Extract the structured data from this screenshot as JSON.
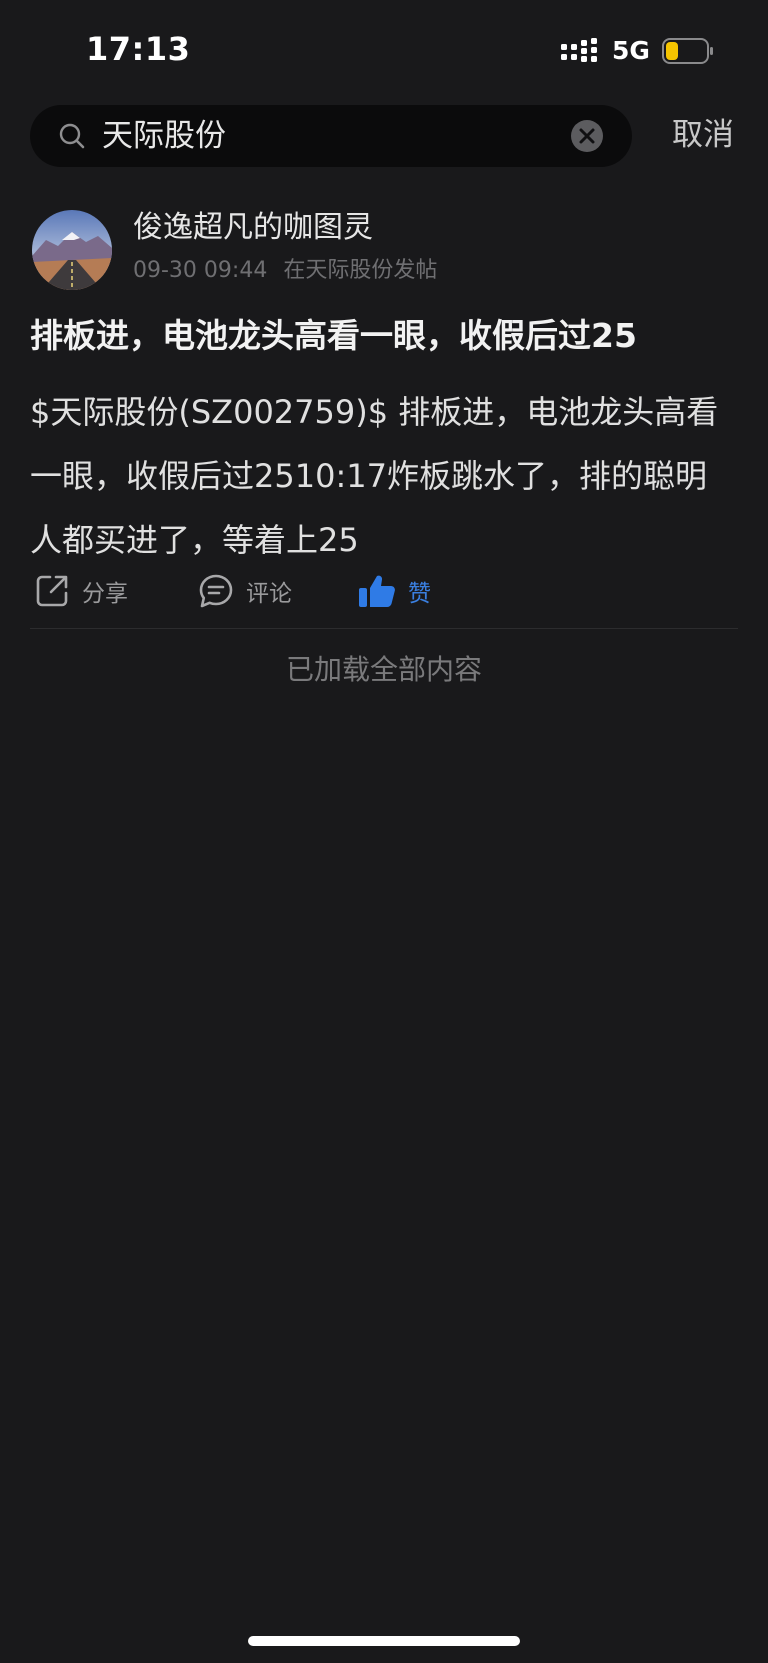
{
  "status_bar": {
    "time": "17:13",
    "network": "5G",
    "battery_level": 0.2,
    "battery_color": "#f5c400"
  },
  "search": {
    "query": "天际股份",
    "cancel_label": "取消"
  },
  "post": {
    "author": "俊逸超凡的咖图灵",
    "timestamp": "09-30 09:44",
    "posted_in": "在天际股份发帖",
    "title": "排板进，电池龙头高看一眼，收假后过25",
    "body": "$天际股份(SZ002759)$ 排板进，电池龙头高看一眼，收假后过2510:17炸板跳水了，排的聪明人都买进了，等着上25"
  },
  "actions": {
    "share_label": "分享",
    "comment_label": "评论",
    "like_label": "赞",
    "like_color": "#2f7be6"
  },
  "footer": {
    "loaded_all": "已加载全部内容"
  }
}
